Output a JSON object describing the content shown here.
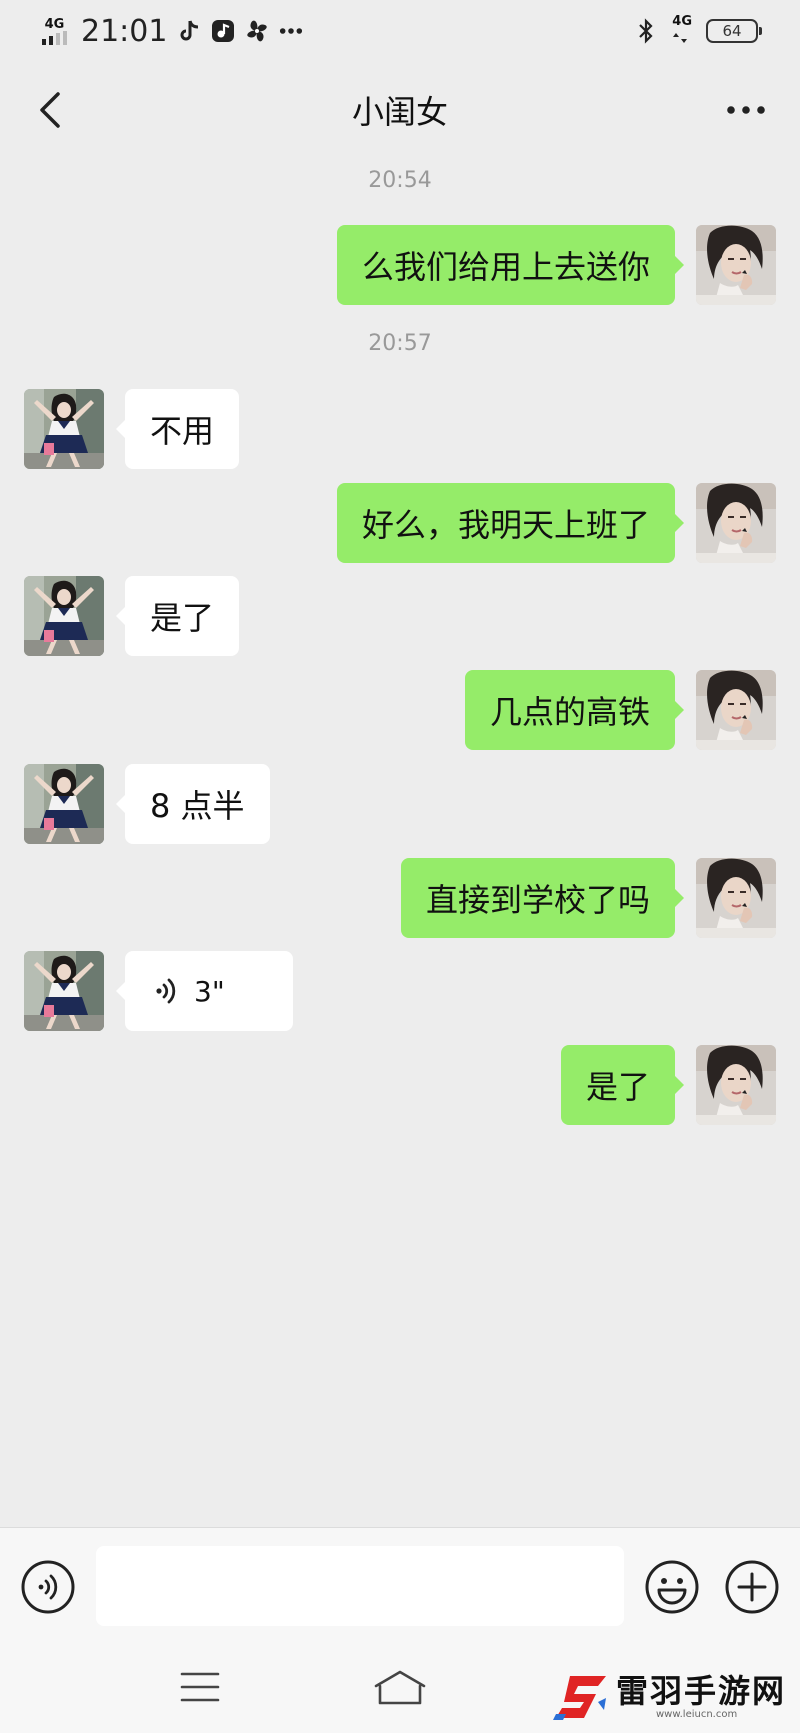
{
  "status_bar": {
    "network_left": "4G",
    "time": "21:01",
    "app_icons": [
      "tiktok-icon",
      "music-app-icon",
      "pinwheel-icon",
      "more-dots-icon"
    ],
    "network_right": "4G",
    "battery": "64",
    "bluetooth_icon": "bluetooth-icon"
  },
  "header": {
    "title": "小闺女",
    "back_icon": "chevron-left-icon",
    "more_icon": "more-horizontal-icon"
  },
  "messages": [
    {
      "kind": "time",
      "text": "20:54"
    },
    {
      "kind": "msg",
      "side": "sent",
      "text": "么我们给用上去送你"
    },
    {
      "kind": "time",
      "text": "20:57"
    },
    {
      "kind": "msg",
      "side": "recv",
      "text": "不用"
    },
    {
      "kind": "msg",
      "side": "sent",
      "text": "好么，我明天上班了"
    },
    {
      "kind": "msg",
      "side": "recv",
      "text": "是了"
    },
    {
      "kind": "msg",
      "side": "sent",
      "text": "几点的高铁"
    },
    {
      "kind": "msg",
      "side": "recv",
      "text": "8 点半"
    },
    {
      "kind": "msg",
      "side": "sent",
      "text": "直接到学校了吗"
    },
    {
      "kind": "voice",
      "side": "recv",
      "duration": "3\""
    },
    {
      "kind": "msg",
      "side": "sent",
      "text": "是了"
    }
  ],
  "input_bar": {
    "voice_icon": "voice-mode-icon",
    "input_value": "",
    "emoji_icon": "emoji-icon",
    "plus_icon": "plus-circle-icon"
  },
  "system_nav": {
    "menu_icon": "menu-icon",
    "home_icon": "home-icon"
  },
  "watermark": {
    "title": "雷羽手游网",
    "url": "www.leiucn.com"
  },
  "colors": {
    "background": "#ededed",
    "sent_bubble": "#95ec69",
    "recv_bubble": "#ffffff",
    "timestamp": "#999999",
    "watermark_logo_red": "#e02424",
    "watermark_logo_blue": "#2b6fd6"
  }
}
